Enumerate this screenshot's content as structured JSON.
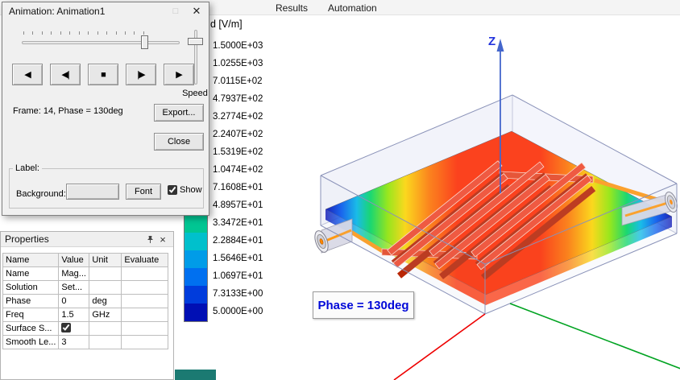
{
  "menu": {
    "items": [
      "Results",
      "Automation"
    ]
  },
  "icons": {
    "dialog_maximize": "□",
    "dialog_close": "✕",
    "panel_close": "×"
  },
  "animation_dialog": {
    "title": "Animation: Animation1",
    "frame_info": "Frame: 14, Phase = 130deg",
    "speed_label": "Speed",
    "export_label": "Export...",
    "close_label": "Close",
    "playback": [
      {
        "name": "play-reverse",
        "glyph": "◀"
      },
      {
        "name": "step-back",
        "glyph": "◀|"
      },
      {
        "name": "stop",
        "glyph": "■"
      },
      {
        "name": "step-forward",
        "glyph": "|▶"
      },
      {
        "name": "play-forward",
        "glyph": "▶"
      }
    ],
    "label_group": {
      "title": "Label:",
      "background_label": "Background:",
      "font_label": "Font",
      "show_label": "Show",
      "show_checked": true
    }
  },
  "properties_panel": {
    "title": "Properties",
    "columns": [
      "Name",
      "Value",
      "Unit",
      "Evaluate"
    ],
    "rows": [
      {
        "name": "Name",
        "value": "Mag...",
        "unit": "",
        "evaluate": "",
        "checkbox": false
      },
      {
        "name": "Solution",
        "value": "Set...",
        "unit": "",
        "evaluate": "",
        "checkbox": false
      },
      {
        "name": "Phase",
        "value": "0",
        "unit": "deg",
        "evaluate": "",
        "checkbox": false
      },
      {
        "name": "Freq",
        "value": "1.5",
        "unit": "GHz",
        "evaluate": "",
        "checkbox": false
      },
      {
        "name": "Surface S...",
        "value": "",
        "unit": "",
        "evaluate": "",
        "checkbox": true,
        "checked": true
      },
      {
        "name": "Smooth Le...",
        "value": "3",
        "unit": "",
        "evaluate": "",
        "checkbox": false
      }
    ]
  },
  "legend": {
    "title": "d [V/m]",
    "entries": [
      {
        "value": "1.5000E+03",
        "color": "#ff1500"
      },
      {
        "value": "1.0255E+03",
        "color": "#ff4700"
      },
      {
        "value": "7.0115E+02",
        "color": "#ff7b00"
      },
      {
        "value": "4.7937E+02",
        "color": "#ffa800"
      },
      {
        "value": "3.2774E+02",
        "color": "#ffd300"
      },
      {
        "value": "2.2407E+02",
        "color": "#fff700"
      },
      {
        "value": "1.5319E+02",
        "color": "#ccf000"
      },
      {
        "value": "1.0474E+02",
        "color": "#8fe000"
      },
      {
        "value": "7.1608E+01",
        "color": "#3ed100"
      },
      {
        "value": "4.8957E+01",
        "color": "#00c235"
      },
      {
        "value": "3.3472E+01",
        "color": "#00c693"
      },
      {
        "value": "2.2884E+01",
        "color": "#00c0cc"
      },
      {
        "value": "1.5646E+01",
        "color": "#009ce8"
      },
      {
        "value": "1.0697E+01",
        "color": "#0070f0"
      },
      {
        "value": "7.3133E+00",
        "color": "#003cdc"
      },
      {
        "value": "5.0000E+00",
        "color": "#000fb4"
      }
    ]
  },
  "viewport": {
    "phase_label": "Phase = 130deg",
    "z_axis_label": "Z",
    "axis_colors": {
      "x": "#ee0000",
      "y": "#00a321",
      "z": "#4466cc"
    }
  }
}
